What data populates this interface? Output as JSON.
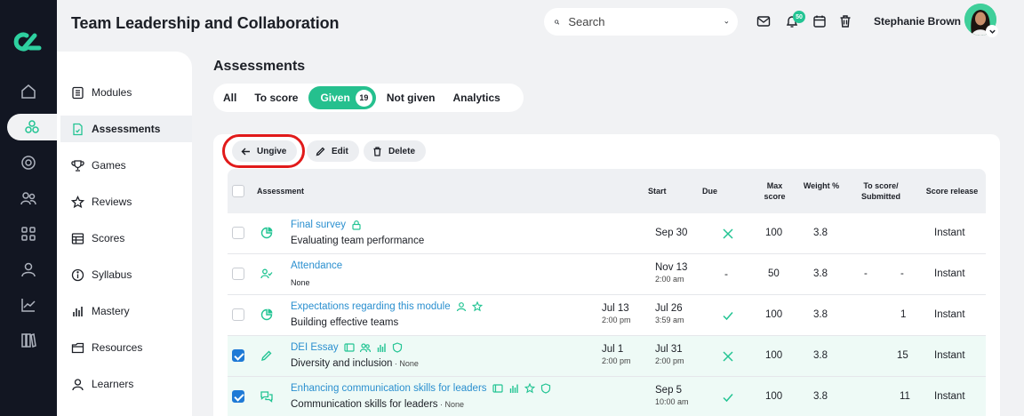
{
  "header": {
    "title": "Team Leadership and Collaboration",
    "search_placeholder": "Search",
    "notification_count": "50",
    "user_name": "Stephanie Brown"
  },
  "rail": {
    "items": [
      "home-icon",
      "course-icon",
      "target-icon",
      "users-icon",
      "grid-icon",
      "person-icon",
      "chart-icon",
      "library-icon"
    ],
    "active_index": 1
  },
  "subnav": {
    "items": [
      {
        "label": "Modules",
        "icon": "modules-icon"
      },
      {
        "label": "Assessments",
        "icon": "assessments-icon"
      },
      {
        "label": "Games",
        "icon": "trophy-icon"
      },
      {
        "label": "Reviews",
        "icon": "star-icon"
      },
      {
        "label": "Scores",
        "icon": "scores-icon"
      },
      {
        "label": "Syllabus",
        "icon": "info-icon"
      },
      {
        "label": "Mastery",
        "icon": "bars-icon"
      },
      {
        "label": "Resources",
        "icon": "resources-icon"
      },
      {
        "label": "Learners",
        "icon": "learner-icon"
      }
    ],
    "active_index": 1
  },
  "main": {
    "title": "Assessments",
    "tabs": [
      {
        "label": "All"
      },
      {
        "label": "To score"
      },
      {
        "label": "Given",
        "count": "19"
      },
      {
        "label": "Not given"
      },
      {
        "label": "Analytics"
      }
    ],
    "active_tab": "Given",
    "actions": {
      "ungive": "Ungive",
      "edit": "Edit",
      "delete": "Delete"
    }
  },
  "table": {
    "headers": {
      "assessment": "Assessment",
      "start": "Start",
      "due": "Due",
      "max_score": "Max score",
      "weight": "Weight %",
      "to_score": "To score/ Submitted",
      "release": "Score release"
    },
    "rows": [
      {
        "name": "Final survey",
        "sub": "Evaluating team performance",
        "sub_note": "",
        "start_date": "",
        "start_time": "",
        "due_date": "Sep 30",
        "due_time": "",
        "due_status": "x",
        "max": "100",
        "weight": "3.8",
        "to_score": "",
        "submitted": "",
        "release": "Instant",
        "checked": false
      },
      {
        "name": "Attendance",
        "sub": "None",
        "sub_note": "",
        "start_date": "",
        "start_time": "",
        "due_date": "Nov 13",
        "due_time": "2:00 am",
        "due_status": "-",
        "max": "50",
        "weight": "3.8",
        "to_score": "-",
        "submitted": "-",
        "release": "Instant",
        "checked": false
      },
      {
        "name": "Expectations regarding this module",
        "sub": "Building effective teams",
        "sub_note": "",
        "start_date": "Jul 13",
        "start_time": "2:00 pm",
        "due_date": "Jul 26",
        "due_time": "3:59 am",
        "due_status": "check",
        "max": "100",
        "weight": "3.8",
        "to_score": "",
        "submitted": "1",
        "release": "Instant",
        "checked": false
      },
      {
        "name": "DEI Essay",
        "sub": "Diversity and inclusion",
        "sub_note": " · None",
        "start_date": "Jul 1",
        "start_time": "2:00 pm",
        "due_date": "Jul 31",
        "due_time": "2:00 pm",
        "due_status": "x",
        "max": "100",
        "weight": "3.8",
        "to_score": "",
        "submitted": "15",
        "release": "Instant",
        "checked": true
      },
      {
        "name": "Enhancing communication skills for leaders",
        "sub": "Communication skills for leaders",
        "sub_note": " · None",
        "start_date": "",
        "start_time": "",
        "due_date": "Sep 5",
        "due_time": "10:00 am",
        "due_status": "check",
        "max": "100",
        "weight": "3.8",
        "to_score": "",
        "submitted": "11",
        "release": "Instant",
        "checked": true
      }
    ]
  },
  "colors": {
    "accent": "#25c08e",
    "link": "#2a8fcf",
    "rail": "#121622",
    "highlight_ring": "#e11a1a"
  }
}
